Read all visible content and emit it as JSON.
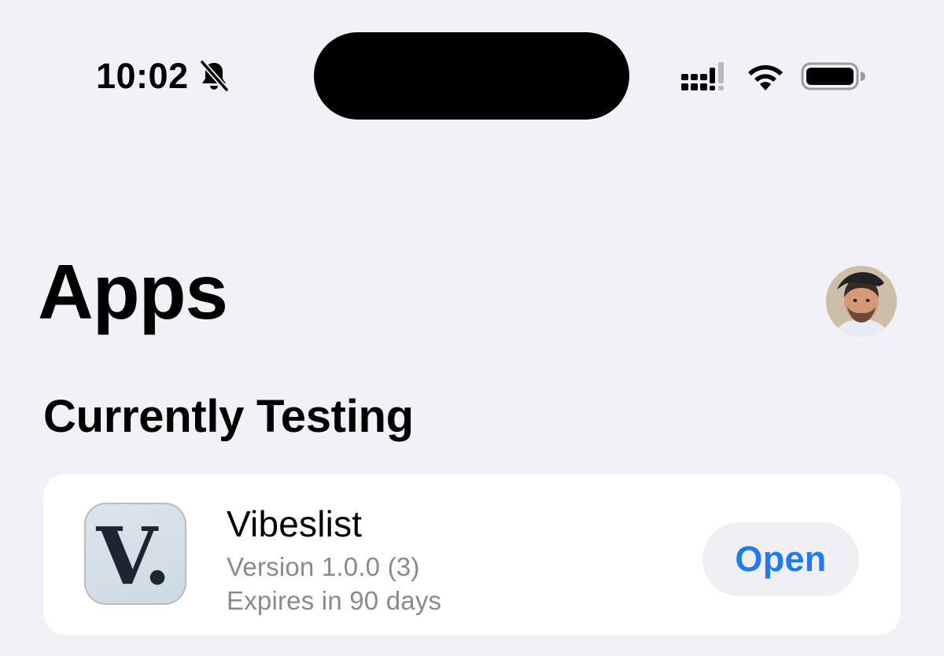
{
  "status_bar": {
    "time": "10:02",
    "icons": [
      "bell-slash-icon",
      "signal-icon",
      "wifi-icon",
      "battery-icon"
    ]
  },
  "header": {
    "title": "Apps",
    "avatar_icon": "user-avatar"
  },
  "section": {
    "title": "Currently Testing"
  },
  "apps": [
    {
      "icon_letter": "V.",
      "name": "Vibeslist",
      "version": "Version 1.0.0 (3)",
      "expiry": "Expires in 90 days",
      "action_label": "Open"
    }
  ],
  "colors": {
    "background": "#f1f1f7",
    "card": "#ffffff",
    "accent": "#1f7bf0",
    "secondary_text": "#8a8a8e",
    "button_bg": "#efeff4"
  }
}
